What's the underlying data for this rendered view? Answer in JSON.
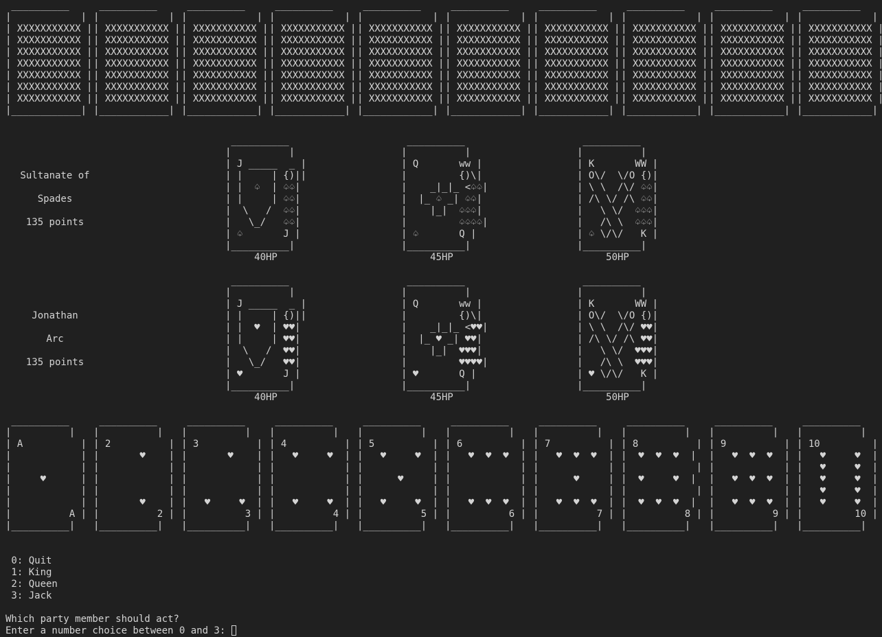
{
  "deck_row": {
    "card_lines": [
      " __________ ",
      "|          |",
      "| XXXXXXXXXXX |",
      "| XXXXXXXXXXX |",
      "| XXXXXXXXXXX |",
      "| XXXXXXXXXXX |",
      "| XXXXXXXXXXX |",
      "| XXXXXXXXXXX |",
      "| XXXXXXXXXXX |",
      "|__________|"
    ],
    "count": 10
  },
  "enemy_party": {
    "name_line1": "Sultanate of",
    "name_line2": "Spades",
    "points": "135 points",
    "cards": [
      {
        "art": " __________\n|          |\n| J _____  _ |\n| |     | {)||\n| |  ♤  | ♤♤|\n| |     | ♤♤|\n|  \\   /  ♤♤|\n|   \\_/   ♤♤|\n| ♤       J |\n|__________|",
        "hp": "40HP"
      },
      {
        "art": " __________\n|          |\n| Q       ww |\n|         {)\\|\n|    _|_|_ <♤♤|\n|  |_ ♤ _| ♤♤|\n|    |_|  ♤♤♤|\n|         ♤♤♤♤|\n| ♤       Q |\n|__________|",
        "hp": "45HP"
      },
      {
        "art": " __________\n|          |\n| K       WW |\n| O\\/  \\/O {)|\n| \\ \\  /\\/ ♤♤|\n| /\\ \\/ /\\ ♤♤|\n|   \\ \\/  ♤♤♤|\n|   /\\ \\  ♤♤♤|\n| ♤ \\/\\/   K |\n|__________|",
        "hp": "50HP"
      }
    ]
  },
  "player_party": {
    "name_line1": "Jonathan",
    "name_line2": "Arc",
    "points": "135 points",
    "cards": [
      {
        "art": " __________\n|          |\n| J _____  _ |\n| |     | {)||\n| |  ♥  | ♥♥|\n| |     | ♥♥|\n|  \\   /  ♥♥|\n|   \\_/   ♥♥|\n| ♥       J |\n|__________|",
        "hp": "40HP"
      },
      {
        "art": " __________\n|          |\n| Q       ww |\n|         {)\\|\n|    _|_|_ <♥♥|\n|  |_ ♥ _| ♥♥|\n|    |_|  ♥♥♥|\n|         ♥♥♥♥|\n| ♥       Q |\n|__________|",
        "hp": "45HP"
      },
      {
        "art": " __________\n|          |\n| K       WW |\n| O\\/  \\/O {)|\n| \\ \\  /\\/ ♥♥|\n| /\\ \\/ /\\ ♥♥|\n|   \\ \\/  ♥♥♥|\n|   /\\ \\  ♥♥♥|\n| ♥ \\/\\/   K |\n|__________|",
        "hp": "50HP"
      }
    ]
  },
  "hand": [
    " __________\n|          |\n| A          |\n|            |\n|            |\n|     ♥      |\n|            |\n|            |\n|          A |\n|__________|",
    " __________\n|          |\n| 2          |\n|       ♥    |\n|            |\n|            |\n|            |\n|       ♥    |\n|          2 |\n|__________|",
    " __________\n|          |\n| 3          |\n|       ♥    |\n|            |\n|            |\n|            |\n|   ♥     ♥  |\n|          3 |\n|__________|",
    " __________\n|          |\n| 4          |\n|   ♥     ♥  |\n|            |\n|            |\n|            |\n|   ♥     ♥  |\n|          4 |\n|__________|",
    " __________\n|          |\n| 5          |\n|   ♥     ♥  |\n|            |\n|      ♥     |\n|            |\n|   ♥     ♥  |\n|          5 |\n|__________|",
    " __________\n|          |\n| 6          |\n|   ♥  ♥  ♥  |\n|            |\n|            |\n|            |\n|   ♥  ♥  ♥  |\n|          6 |\n|__________|",
    " __________\n|          |\n| 7          |\n|   ♥  ♥  ♥  |\n|            |\n|      ♥     |\n|            |\n|   ♥  ♥  ♥  |\n|          7 |\n|__________|",
    " __________\n|          |\n| 8          |\n|  ♥  ♥  ♥  |\n|            |\n|  ♥     ♥  |\n|            |\n|  ♥  ♥  ♥  |\n|          8 |\n|__________|",
    " __________\n|          |\n| 9          |\n|   ♥  ♥  ♥  |\n|            |\n|   ♥  ♥  ♥  |\n|            |\n|   ♥  ♥  ♥  |\n|          9 |\n|__________|",
    " __________\n|          |\n| 10         |\n|   ♥     ♥  |\n|   ♥     ♥  |\n|   ♥     ♥  |\n|   ♥     ♥  |\n|   ♥     ♥  |\n|         10 |\n|__________|"
  ],
  "menu": {
    "options": [
      " 0: Quit",
      " 1: King",
      " 2: Queen",
      " 3: Jack"
    ],
    "question": "Which party member should act?",
    "prompt": "Enter a number choice between 0 and 3: "
  },
  "colors": {
    "background": "#202020",
    "text": "#d4d4d4"
  }
}
